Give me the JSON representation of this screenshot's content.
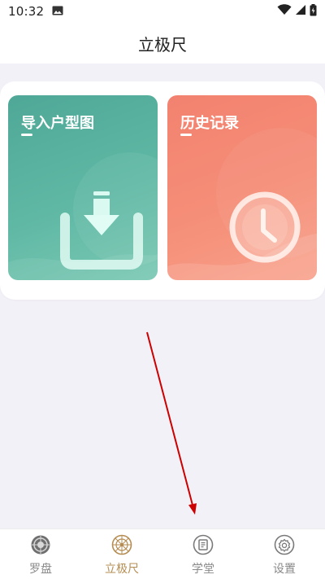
{
  "status_bar": {
    "time": "10:32",
    "icons": [
      "image-icon",
      "wifi-icon",
      "signal-icon",
      "battery-icon"
    ]
  },
  "header": {
    "title": "立极尺"
  },
  "tiles": [
    {
      "title": "导入户型图",
      "icon": "import-download-icon",
      "color": "#5fb8a4"
    },
    {
      "title": "历史记录",
      "icon": "clock-icon",
      "color": "#f58e78"
    }
  ],
  "bottom_nav": {
    "items": [
      {
        "label": "罗盘",
        "icon": "compass-icon",
        "active": false
      },
      {
        "label": "立极尺",
        "icon": "liji-ruler-icon",
        "active": true
      },
      {
        "label": "学堂",
        "icon": "book-icon",
        "active": false
      },
      {
        "label": "设置",
        "icon": "gear-icon",
        "active": false
      }
    ]
  },
  "colors": {
    "accent": "#b58d52",
    "import_tile": "#5fb8a4",
    "history_tile": "#f58e78",
    "annotation_arrow": "#cc0000",
    "page_background": "#f2f1f7"
  }
}
